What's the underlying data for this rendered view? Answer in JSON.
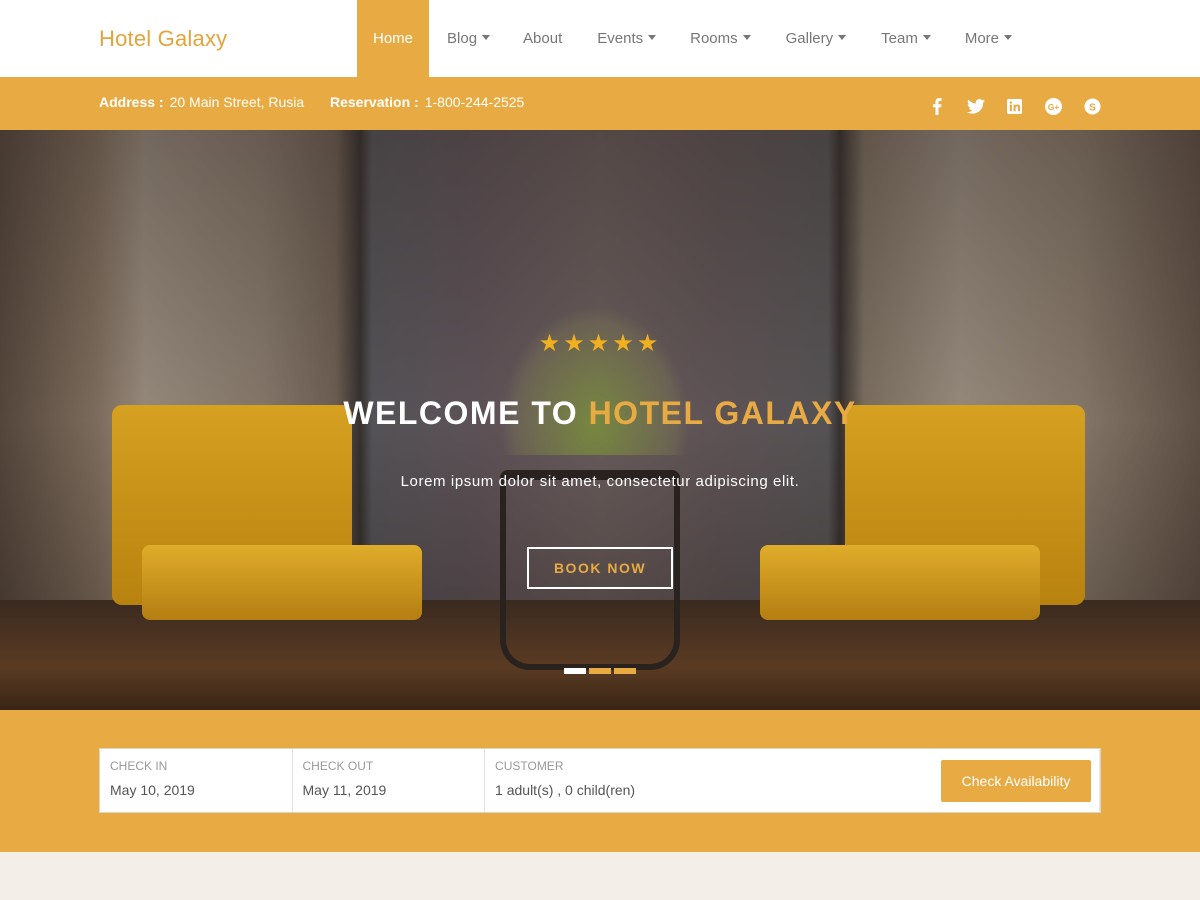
{
  "brand": {
    "name": "Hotel Galaxy"
  },
  "nav": {
    "items": [
      {
        "label": "Home",
        "active": true,
        "dropdown": false
      },
      {
        "label": "Blog",
        "active": false,
        "dropdown": true
      },
      {
        "label": "About",
        "active": false,
        "dropdown": false
      },
      {
        "label": "Events",
        "active": false,
        "dropdown": true
      },
      {
        "label": "Rooms",
        "active": false,
        "dropdown": true
      },
      {
        "label": "Gallery",
        "active": false,
        "dropdown": true
      },
      {
        "label": "Team",
        "active": false,
        "dropdown": true
      },
      {
        "label": "More",
        "active": false,
        "dropdown": true
      }
    ]
  },
  "infobar": {
    "address_label": "Address :",
    "address_value": "20 Main Street, Rusia",
    "reservation_label": "Reservation :",
    "reservation_value": "1-800-244-2525",
    "social": [
      "facebook-icon",
      "twitter-icon",
      "linkedin-icon",
      "google-plus-icon",
      "skype-icon"
    ]
  },
  "hero": {
    "stars": "★★★★★",
    "title_prefix": "WELCOME TO",
    "title_highlight": "HOTEL GALAXY",
    "subtitle": "Lorem ipsum dolor sit amet, consectetur adipiscing elit.",
    "button": "BOOK NOW",
    "slides": 3,
    "active_slide": 1
  },
  "booking": {
    "checkin_label": "CHECK IN",
    "checkin_value": "May 10, 2019",
    "checkout_label": "CHECK OUT",
    "checkout_value": "May 11, 2019",
    "customer_label": "CUSTOMER",
    "customer_value": "1 adult(s) , 0 child(ren)",
    "button": "Check Availability"
  },
  "colors": {
    "accent": "#e8aa42",
    "star": "#f2b01e",
    "nav_text": "#777777"
  }
}
